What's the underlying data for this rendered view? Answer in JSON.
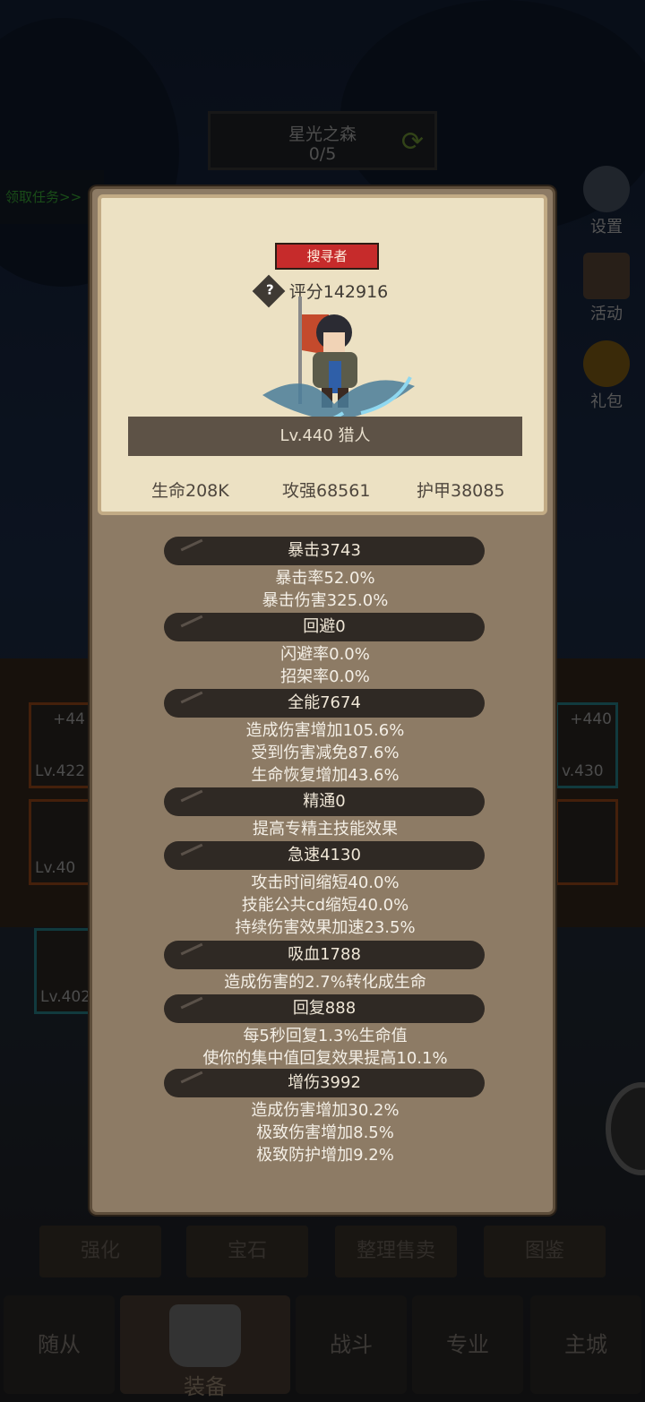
{
  "zone": {
    "name": "星光之森",
    "progress": "0/5"
  },
  "quest_label": "领取任务>>",
  "side_menu": [
    "设置",
    "活动",
    "礼包"
  ],
  "equip_slots": [
    {
      "plus": "+44",
      "level": "Lv.422"
    },
    {
      "plus": "",
      "level": "Lv.40"
    },
    {
      "plus": "+440",
      "level": "v.430"
    },
    {
      "plus": "",
      "level": "Lv.402"
    }
  ],
  "action_buttons": [
    "强化",
    "宝石",
    "整理售卖",
    "图鉴"
  ],
  "nav": [
    "随从",
    "装备",
    "战斗",
    "专业",
    "主城"
  ],
  "popup": {
    "class_name": "搜寻者",
    "score": "评分142916",
    "help": "?",
    "level_title": "Lv.440 猎人",
    "basic": {
      "hp": "生命208K",
      "attack": "攻强68561",
      "armor": "护甲38085"
    },
    "sections": [
      {
        "title": "暴击3743",
        "lines": [
          "暴击率52.0%",
          "暴击伤害325.0%"
        ]
      },
      {
        "title": "回避0",
        "lines": [
          "闪避率0.0%",
          "招架率0.0%"
        ]
      },
      {
        "title": "全能7674",
        "lines": [
          "造成伤害增加105.6%",
          "受到伤害减免87.6%",
          "生命恢复增加43.6%"
        ]
      },
      {
        "title": "精通0",
        "lines": [
          "提高专精主技能效果"
        ]
      },
      {
        "title": "急速4130",
        "lines": [
          "攻击时间缩短40.0%",
          "技能公共cd缩短40.0%",
          "持续伤害效果加速23.5%"
        ]
      },
      {
        "title": "吸血1788",
        "lines": [
          "造成伤害的2.7%转化成生命"
        ]
      },
      {
        "title": "回复888",
        "lines": [
          "每5秒回复1.3%生命值",
          "使你的集中值回复效果提高10.1%"
        ]
      },
      {
        "title": "增伤3992",
        "lines": [
          "造成伤害增加30.2%",
          "极致伤害增加8.5%",
          "极致防护增加9.2%"
        ]
      }
    ]
  },
  "colors": {
    "panel": "#8d7b65",
    "card": "#ece1c3",
    "tag": "#c62b2b",
    "section": "#2f2924"
  }
}
